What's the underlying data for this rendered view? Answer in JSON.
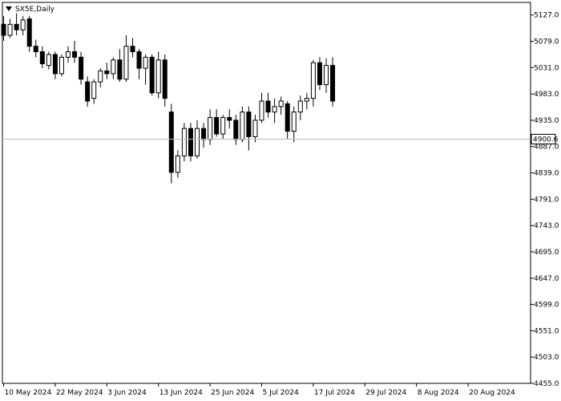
{
  "chart_data": {
    "type": "candlestick",
    "symbol_label": "SX5E,Daily",
    "last_price_label": "4900.6",
    "ylim": [
      4455,
      5150
    ],
    "y_ticks": [
      "5127.0",
      "5079.0",
      "5031.0",
      "4983.0",
      "4935.0",
      "4887.0",
      "4839.0",
      "4791.0",
      "4743.0",
      "4695.0",
      "4647.0",
      "4599.0",
      "4551.0",
      "4503.0",
      "4455.0"
    ],
    "x_ticks": [
      {
        "label": "10 May 2024",
        "index": 0
      },
      {
        "label": "22 May 2024",
        "index": 8
      },
      {
        "label": "3 Jun 2024",
        "index": 16
      },
      {
        "label": "13 Jun 2024",
        "index": 24
      },
      {
        "label": "25 Jun 2024",
        "index": 32
      },
      {
        "label": "5 Jul 2024",
        "index": 40
      },
      {
        "label": "17 Jul 2024",
        "index": 48
      },
      {
        "label": "29 Jul 2024",
        "index": 56
      },
      {
        "label": "8 Aug 2024",
        "index": 64
      },
      {
        "label": "20 Aug 2024",
        "index": 72
      }
    ],
    "candles": [
      [
        5110,
        5125,
        5080,
        5090
      ],
      [
        5090,
        5120,
        5085,
        5110
      ],
      [
        5110,
        5130,
        5090,
        5100
      ],
      [
        5100,
        5125,
        5090,
        5118
      ],
      [
        5120,
        5125,
        5060,
        5070
      ],
      [
        5070,
        5082,
        5050,
        5060
      ],
      [
        5060,
        5070,
        5030,
        5038
      ],
      [
        5035,
        5060,
        5028,
        5055
      ],
      [
        5055,
        5060,
        5010,
        5020
      ],
      [
        5020,
        5055,
        5015,
        5050
      ],
      [
        5050,
        5070,
        5040,
        5060
      ],
      [
        5060,
        5080,
        5040,
        5050
      ],
      [
        5050,
        5060,
        5000,
        5010
      ],
      [
        5005,
        5015,
        4960,
        4970
      ],
      [
        4975,
        5010,
        4965,
        5005
      ],
      [
        5005,
        5030,
        4995,
        5025
      ],
      [
        5025,
        5040,
        5010,
        5020
      ],
      [
        5020,
        5050,
        5010,
        5045
      ],
      [
        5045,
        5065,
        5005,
        5010
      ],
      [
        5010,
        5090,
        5005,
        5070
      ],
      [
        5070,
        5085,
        5050,
        5060
      ],
      [
        5060,
        5065,
        5010,
        5030
      ],
      [
        5030,
        5055,
        5000,
        5050
      ],
      [
        5050,
        5055,
        4980,
        4985
      ],
      [
        4985,
        5060,
        4975,
        5045
      ],
      [
        5045,
        5055,
        4960,
        4975
      ],
      [
        4950,
        4965,
        4820,
        4840
      ],
      [
        4840,
        4880,
        4830,
        4870
      ],
      [
        4870,
        4930,
        4860,
        4920
      ],
      [
        4920,
        4930,
        4860,
        4870
      ],
      [
        4870,
        4935,
        4865,
        4920
      ],
      [
        4920,
        4930,
        4885,
        4900
      ],
      [
        4900,
        4955,
        4890,
        4940
      ],
      [
        4940,
        4955,
        4905,
        4910
      ],
      [
        4910,
        4945,
        4900,
        4940
      ],
      [
        4940,
        4955,
        4920,
        4935
      ],
      [
        4935,
        4945,
        4890,
        4900
      ],
      [
        4900,
        4960,
        4895,
        4950
      ],
      [
        4950,
        4960,
        4880,
        4905
      ],
      [
        4905,
        4945,
        4895,
        4935
      ],
      [
        4935,
        4985,
        4930,
        4970
      ],
      [
        4970,
        4985,
        4940,
        4950
      ],
      [
        4950,
        4975,
        4930,
        4960
      ],
      [
        4960,
        4978,
        4945,
        4970
      ],
      [
        4965,
        4970,
        4900,
        4915
      ],
      [
        4915,
        4960,
        4895,
        4950
      ],
      [
        4950,
        4980,
        4935,
        4970
      ],
      [
        4970,
        4985,
        4955,
        4975
      ],
      [
        4975,
        5045,
        4960,
        5040
      ],
      [
        5040,
        5050,
        4990,
        5000
      ],
      [
        5000,
        5048,
        4985,
        5035
      ],
      [
        5035,
        5050,
        4960,
        4970
      ]
    ],
    "tenkan": [],
    "kijun": [],
    "chikou": [],
    "senkou_a": [],
    "senkou_b": [],
    "colors": {
      "up_candle_body": "#ffffff",
      "down_candle_body": "#000000",
      "candle_outline": "#000000",
      "tenkan": "#cc0000",
      "kijun": "#0000aa",
      "chikou": "#33dd33",
      "cloud": "#e8a070",
      "grid": "#000000",
      "price_line": "#bbbbbb"
    }
  }
}
